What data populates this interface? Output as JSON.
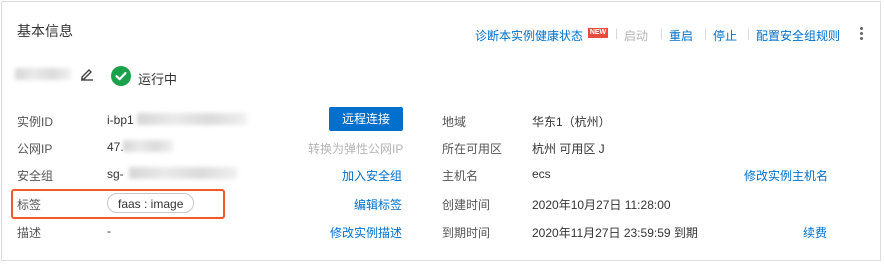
{
  "header": {
    "title": "基本信息"
  },
  "actions": {
    "diagnose": "诊断本实例健康状态",
    "new_badge": "NEW",
    "start": "启动",
    "restart": "重启",
    "stop": "停止",
    "security_rules": "配置安全组规则"
  },
  "instance": {
    "status": "运行中",
    "status_color": "#1aa14b"
  },
  "fields": {
    "instance_id": {
      "label": "实例ID",
      "value": "i-bp1"
    },
    "public_ip": {
      "label": "公网IP",
      "value": "47."
    },
    "security_group": {
      "label": "安全组",
      "value": "sg-"
    },
    "tags": {
      "label": "标签",
      "value": "faas : image"
    },
    "description": {
      "label": "描述",
      "value": "-"
    },
    "region": {
      "label": "地域",
      "value": "华东1（杭州）"
    },
    "zone": {
      "label": "所在可用区",
      "value": "杭州 可用区 J"
    },
    "hostname": {
      "label": "主机名",
      "value": "ecs"
    },
    "created": {
      "label": "创建时间",
      "value": "2020年10月27日 11:28:00"
    },
    "expires": {
      "label": "到期时间",
      "value": "2020年11月27日 23:59:59 到期"
    }
  },
  "buttons": {
    "remote_connect": "远程连接",
    "convert_eip": "转换为弹性公网IP",
    "join_sg": "加入安全组",
    "edit_tags": "编辑标签",
    "edit_desc": "修改实例描述",
    "edit_hostname": "修改实例主机名",
    "renew": "续费"
  },
  "colors": {
    "accent": "#0070cc",
    "highlight_border": "#f05a28",
    "new_badge": "#e84c3d"
  }
}
